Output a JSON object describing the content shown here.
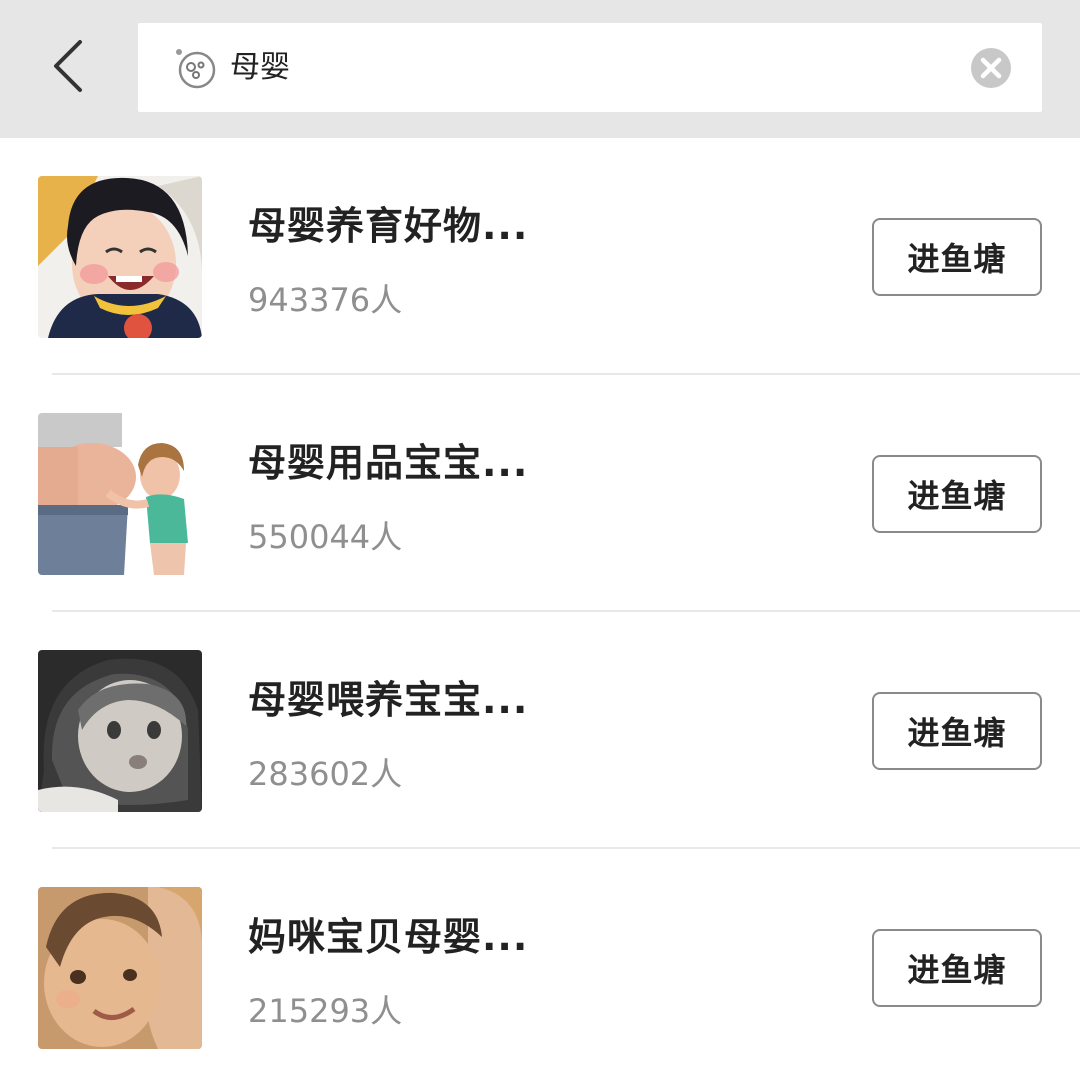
{
  "search": {
    "query": "母婴",
    "emoji_icon": "fish-bubble-icon",
    "clear_icon": "clear-circle-icon"
  },
  "nav": {
    "back_icon": "chevron-left-icon"
  },
  "results": [
    {
      "title": "母婴养育好物...",
      "members": "943376人",
      "button_label": "进鱼塘",
      "thumbnail": "smiling-toddler-photo"
    },
    {
      "title": "母婴用品宝宝...",
      "members": "550044人",
      "button_label": "进鱼塘",
      "thumbnail": "pregnant-belly-child-photo"
    },
    {
      "title": "母婴喂养宝宝...",
      "members": "283602人",
      "button_label": "进鱼塘",
      "thumbnail": "baby-helmet-bw-photo"
    },
    {
      "title": "妈咪宝贝母婴...",
      "members": "215293人",
      "button_label": "进鱼塘",
      "thumbnail": "mother-baby-photo"
    }
  ],
  "colors": {
    "header_bg": "#e6e6e6",
    "title_text": "#222222",
    "count_text": "#8f8f8f",
    "button_border": "#8a8a8a",
    "divider": "#e8e8e8"
  }
}
